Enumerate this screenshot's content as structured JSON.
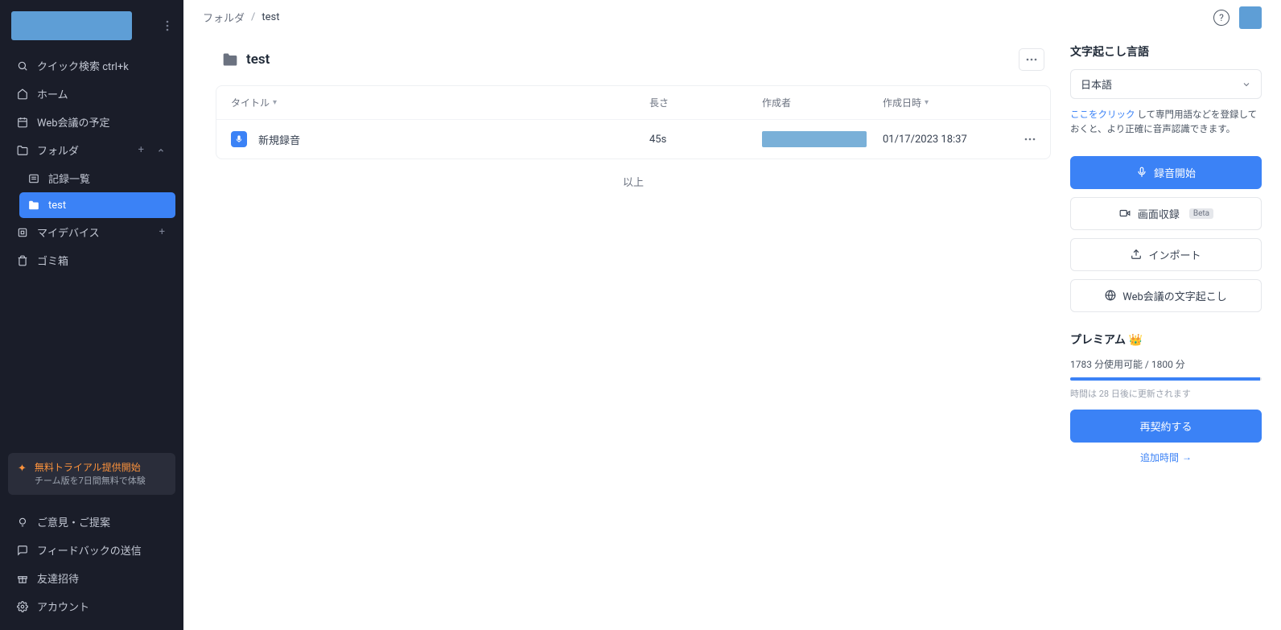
{
  "sidebar": {
    "quick_search": "クイック検索 ctrl+k",
    "home": "ホーム",
    "web_meeting": "Web会議の予定",
    "folder": "フォルダ",
    "records_list": "記録一覧",
    "test_folder": "test",
    "my_device": "マイデバイス",
    "trash": "ゴミ箱",
    "trial": {
      "title": "無料トライアル提供開始",
      "subtitle": "チーム版を7日間無料で体験"
    },
    "feedback_idea": "ご意見・ご提案",
    "send_feedback": "フィードバックの送信",
    "invite": "友達招待",
    "account": "アカウント"
  },
  "breadcrumb": {
    "parent": "フォルダ",
    "current": "test"
  },
  "folder": {
    "name": "test"
  },
  "table": {
    "headers": {
      "title": "タイトル",
      "length": "長さ",
      "author": "作成者",
      "date": "作成日時"
    },
    "rows": [
      {
        "title": "新規録音",
        "length": "45s",
        "date": "01/17/2023 18:37"
      }
    ],
    "end": "以上"
  },
  "rpanel": {
    "lang_title": "文字起こし言語",
    "lang_selected": "日本語",
    "hint_link": "ここをクリック",
    "hint_rest": " して専門用語などを登録しておくと、より正確に音声認識できます。",
    "btn_record": "録音開始",
    "btn_screen": "画面収録",
    "btn_screen_badge": "Beta",
    "btn_import": "インポート",
    "btn_webmeeting": "Web会議の文字起こし",
    "premium_title": "プレミアム",
    "usage_text": "1783 分使用可能 / 1800 分",
    "usage_fill_pct": 99,
    "renew_note": "時間は 28 日後に更新されます",
    "btn_renew": "再契約する",
    "link_add_time": "追加時間"
  }
}
